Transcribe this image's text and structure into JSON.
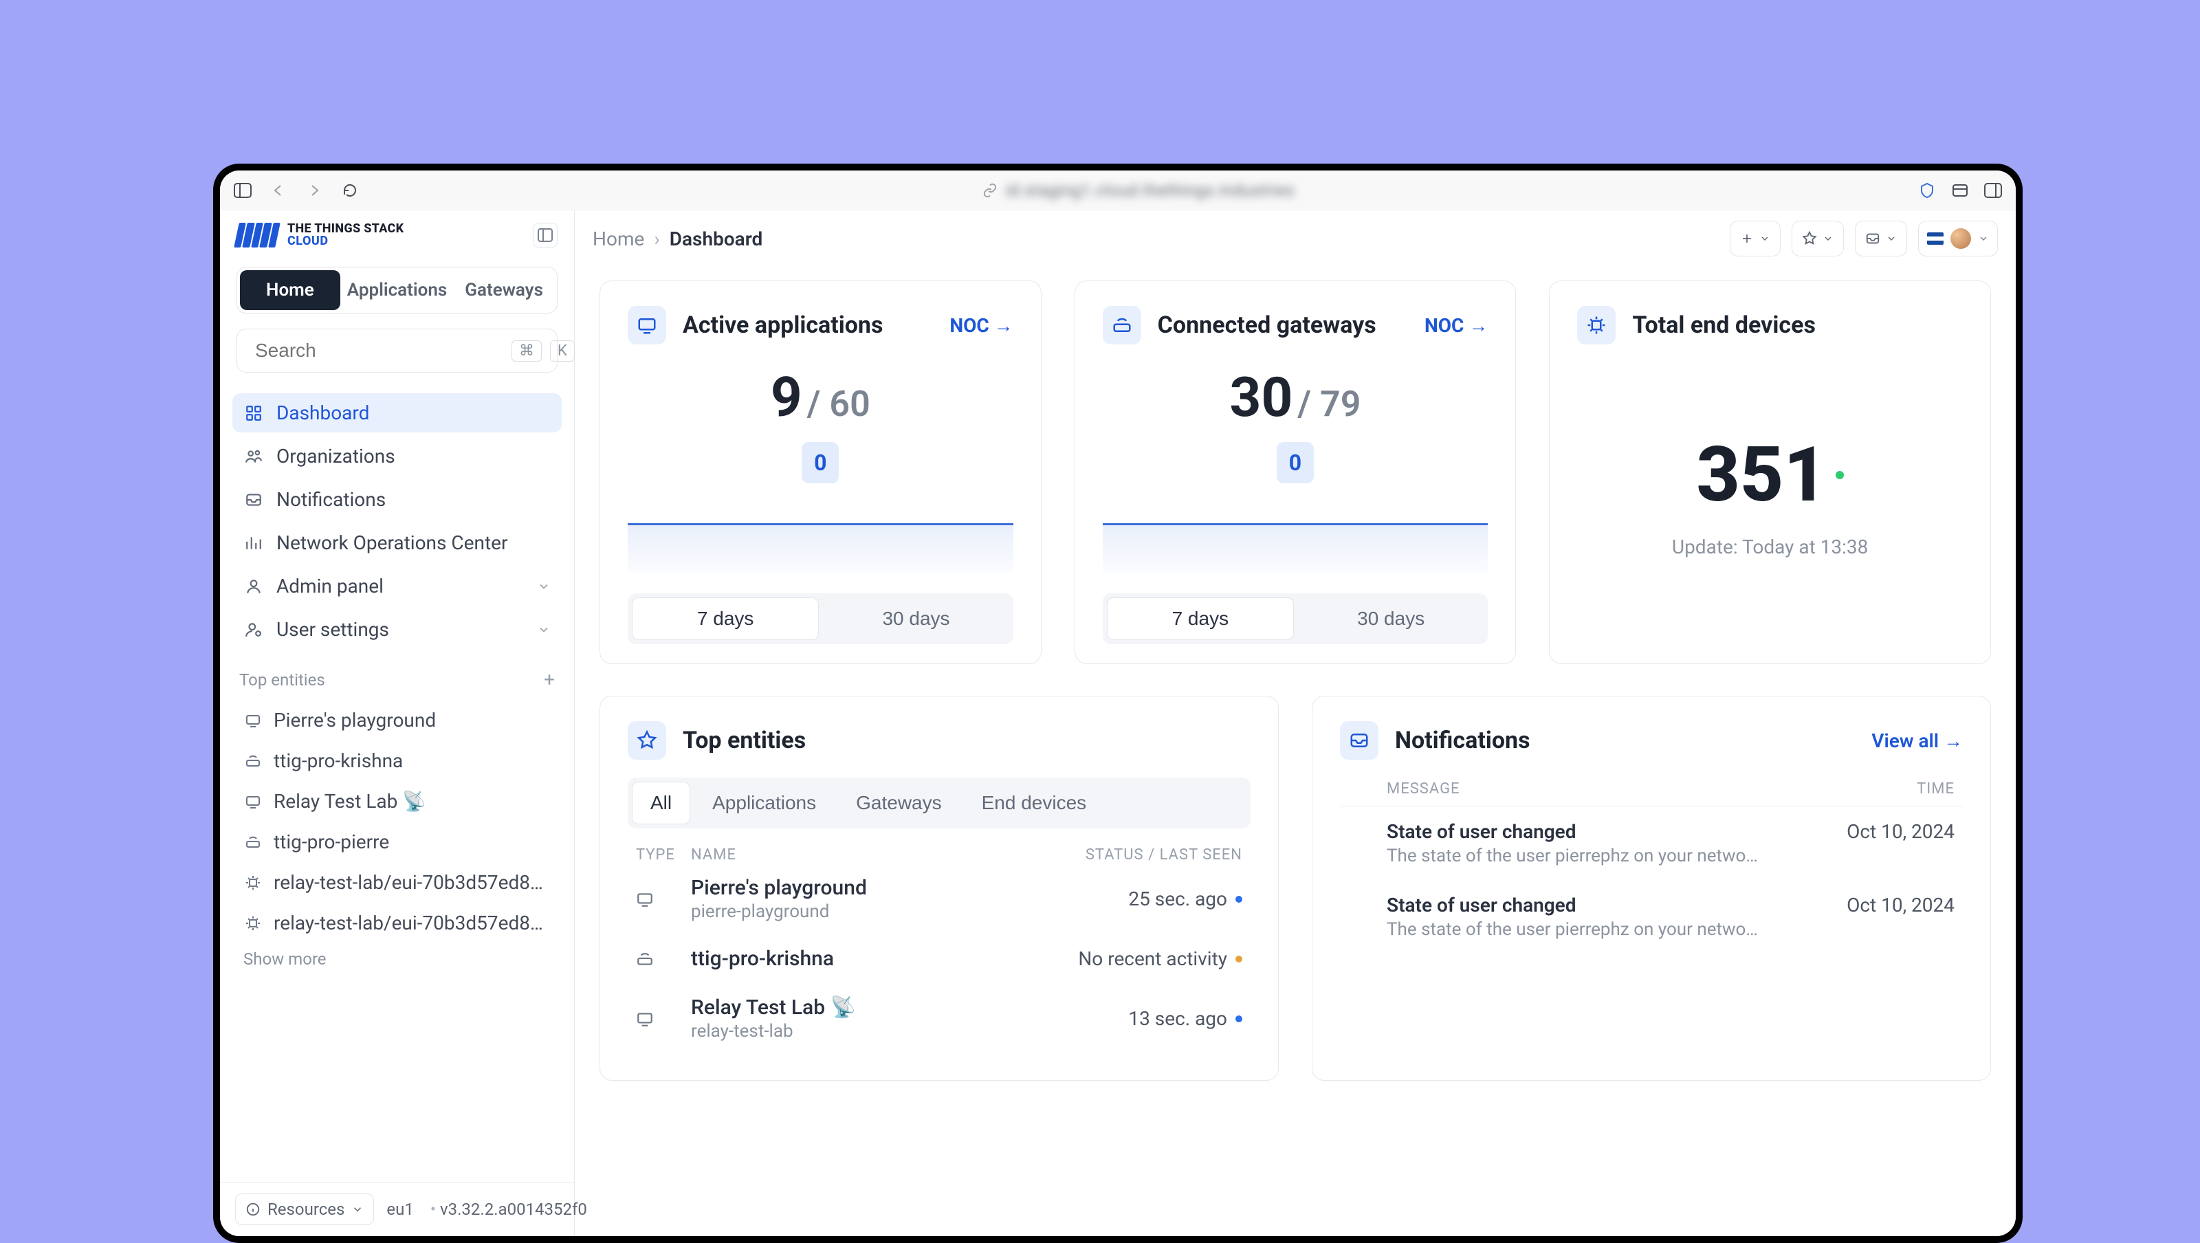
{
  "logo": {
    "line1": "THE THINGS STACK",
    "line2": "CLOUD"
  },
  "nav_tabs": {
    "home": "Home",
    "apps": "Applications",
    "gws": "Gateways"
  },
  "search": {
    "placeholder": "Search",
    "kbd1": "⌘",
    "kbd2": "K"
  },
  "menu": {
    "dashboard": "Dashboard",
    "orgs": "Organizations",
    "notifs": "Notifications",
    "noc": "Network Operations Center",
    "admin": "Admin panel",
    "user": "User settings"
  },
  "section_top_entities": "Top entities",
  "entities": [
    {
      "icon": "app",
      "label": "Pierre's playground"
    },
    {
      "icon": "gw",
      "label": "ttig-pro-krishna"
    },
    {
      "icon": "app",
      "label": "Relay Test Lab 📡"
    },
    {
      "icon": "gw",
      "label": "ttig-pro-pierre"
    },
    {
      "icon": "dev",
      "label": "relay-test-lab/eui-70b3d57ed8000..."
    },
    {
      "icon": "dev",
      "label": "relay-test-lab/eui-70b3d57ed8000..."
    }
  ],
  "show_more": "Show more",
  "footer": {
    "resources": "Resources",
    "cluster": "eu1",
    "version": "v3.32.2.a0014352f0"
  },
  "breadcrumb": {
    "home": "Home",
    "current": "Dashboard"
  },
  "cards": {
    "apps": {
      "title": "Active applications",
      "noc": "NOC →",
      "value": "9",
      "total": "/ 60",
      "pill": "0",
      "seg7": "7 days",
      "seg30": "30 days"
    },
    "gws": {
      "title": "Connected gateways",
      "noc": "NOC →",
      "value": "30",
      "total": "/ 79",
      "pill": "0",
      "seg7": "7 days",
      "seg30": "30 days"
    },
    "devs": {
      "title": "Total end devices",
      "value": "351",
      "update": "Update: Today at 13:38"
    }
  },
  "top_entities_panel": {
    "title": "Top entities",
    "filters": {
      "all": "All",
      "apps": "Applications",
      "gws": "Gateways",
      "devs": "End devices"
    },
    "cols": {
      "type": "TYPE",
      "name": "NAME",
      "status": "STATUS / LAST SEEN"
    },
    "rows": [
      {
        "icon": "app",
        "name": "Pierre's playground",
        "sub": "pierre-playground",
        "status": "25 sec. ago",
        "dot": "green"
      },
      {
        "icon": "gw",
        "name": "ttig-pro-krishna",
        "sub": "",
        "status": "No recent activity",
        "dot": "orange"
      },
      {
        "icon": "app",
        "name": "Relay Test Lab 📡",
        "sub": "relay-test-lab",
        "status": "13 sec. ago",
        "dot": "green"
      }
    ]
  },
  "notifications_panel": {
    "title": "Notifications",
    "view_all": "View all →",
    "cols": {
      "msg": "MESSAGE",
      "time": "TIME"
    },
    "rows": [
      {
        "title": "State of user changed",
        "sub": "The state of the user pierrephz on your network ...",
        "time": "Oct 10, 2024"
      },
      {
        "title": "State of user changed",
        "sub": "The state of the user pierrephz on your network ...",
        "time": "Oct 10, 2024"
      }
    ]
  },
  "url_blur": "id.staging1.cloud.thethings.industries"
}
